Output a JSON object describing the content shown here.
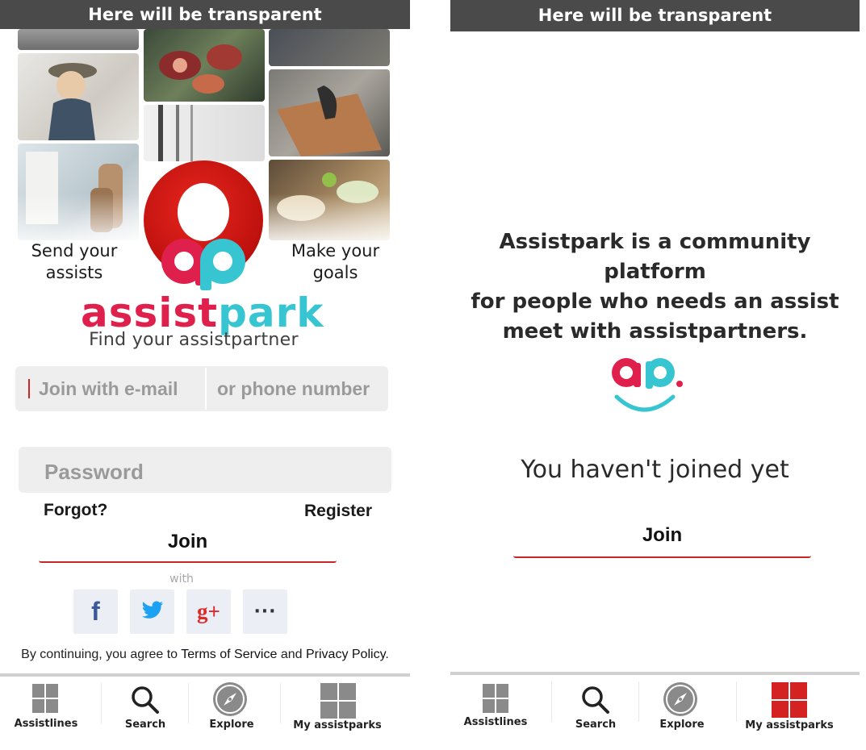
{
  "left_screen": {
    "topbar": "Here will be transparent",
    "tagline_left": "Send your\nassists",
    "tagline_right": "Make your\ngoals",
    "logo_mark": "ap",
    "brand_part1": "assist",
    "brand_part2": "park",
    "slogan": "Find your assistpartner",
    "email_placeholder": "Join with e-mail",
    "phone_placeholder": "or phone number",
    "password_placeholder": "Password",
    "forgot": "Forgot?",
    "register": "Register",
    "join": "Join",
    "with": "with",
    "social": [
      {
        "icon": "facebook-icon",
        "glyph": "f",
        "color": "#3b5998"
      },
      {
        "icon": "twitter-icon",
        "color": "#1da1f2"
      },
      {
        "icon": "google-plus-icon",
        "glyph": "g+",
        "color": "#dd2a2a"
      },
      {
        "icon": "more-icon",
        "glyph": "···",
        "color": "#333333"
      }
    ],
    "terms_prefix": "By continuing, you agree to",
    "terms_link": "Terms of Service",
    "terms_and": "and",
    "privacy_link": "Privacy Policy",
    "terms_suffix": "."
  },
  "right_screen": {
    "topbar": "Here will be transparent",
    "about": "Assistpark is a community platform\nfor people who needs an assist\nmeet with assistpartners.",
    "logo_mark": "ap.",
    "not_joined": "You haven't joined yet",
    "join": "Join"
  },
  "nav": {
    "items": [
      "Assistlines",
      "Search",
      "Explore",
      "My assistparks"
    ],
    "active_color_right": "#d42222",
    "inactive_color": "#8a8a8a"
  },
  "colors": {
    "accent_red": "#c62828",
    "brand_pink": "#e0204c",
    "brand_teal": "#36c5d1"
  }
}
